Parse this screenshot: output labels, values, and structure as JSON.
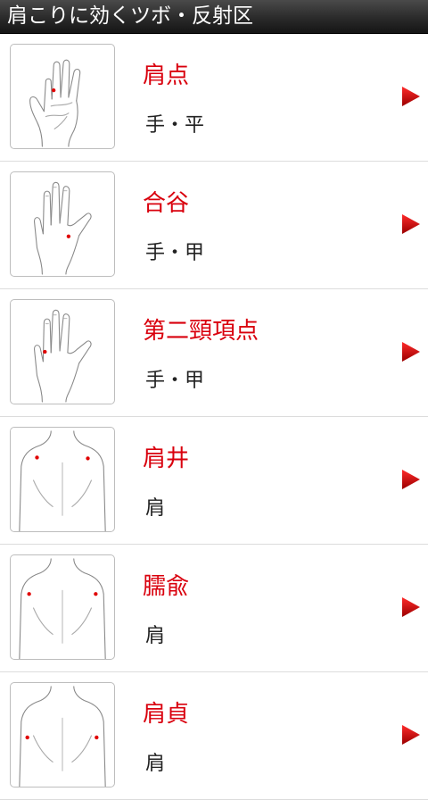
{
  "header": {
    "title": "肩こりに効くツボ・反射区"
  },
  "items": [
    {
      "name": "肩点",
      "area": "手・平",
      "image": "palm-hand-icon"
    },
    {
      "name": "合谷",
      "area": "手・甲",
      "image": "back-hand-icon"
    },
    {
      "name": "第二頸項点",
      "area": "手・甲",
      "image": "back-hand-icon"
    },
    {
      "name": "肩井",
      "area": "肩",
      "image": "upper-back-icon"
    },
    {
      "name": "臑兪",
      "area": "肩",
      "image": "upper-back-icon"
    },
    {
      "name": "肩貞",
      "area": "肩",
      "image": "upper-back-icon"
    }
  ],
  "colors": {
    "accent": "#d9000d",
    "title_bar": "#2a2a2a",
    "divider": "#dcdcdc"
  },
  "icons": {
    "row_arrow": "right-triangle-icon"
  }
}
